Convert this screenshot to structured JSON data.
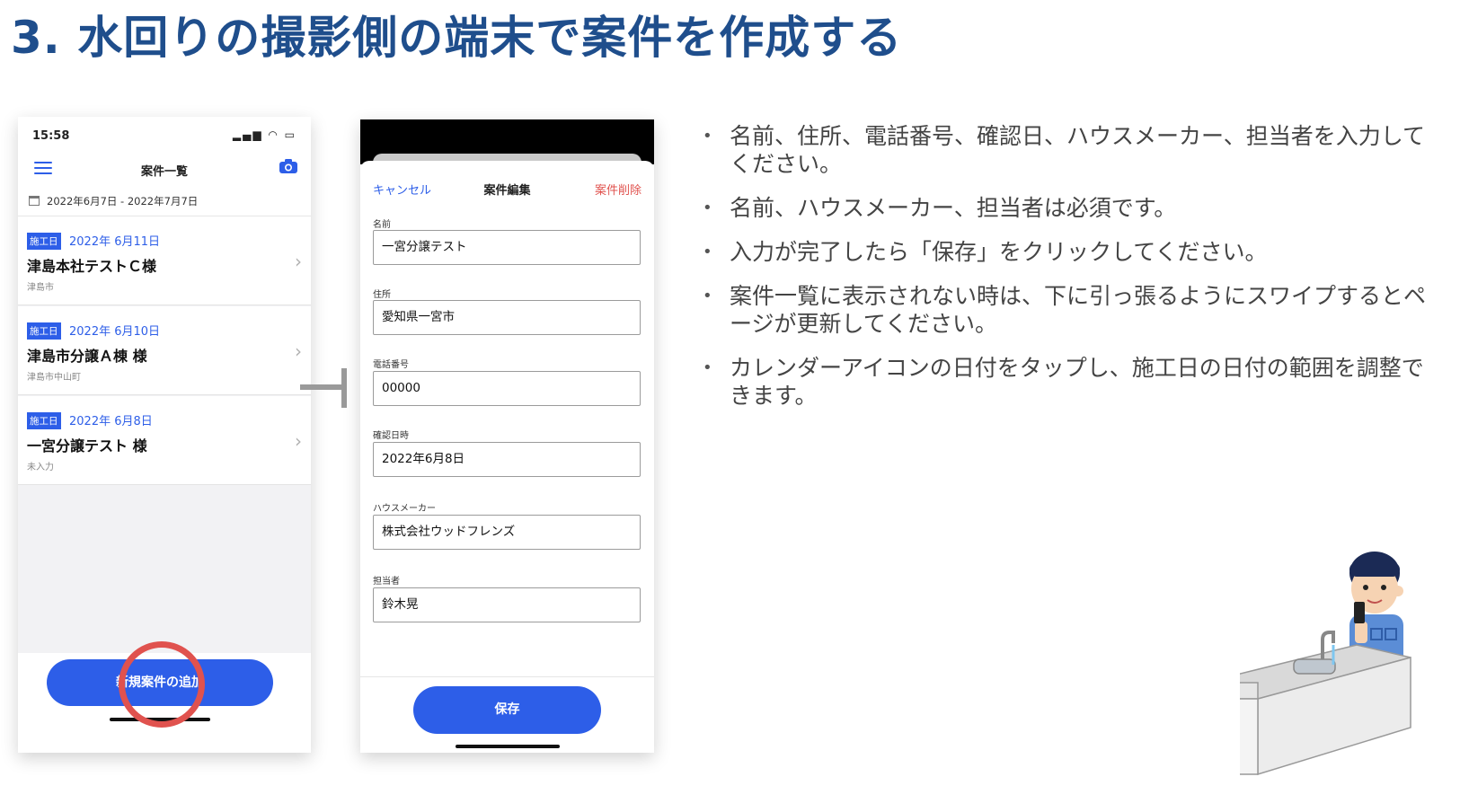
{
  "slide": {
    "title": "3. 水回りの撮影側の端末で案件を作成する"
  },
  "phone1": {
    "time": "15:58",
    "status_icons": "▂▄▆ ◠ ▭",
    "nav_title": "案件一覧",
    "date_range": "2022年6月7日 - 2022年7月7日",
    "items": [
      {
        "badge": "施工日",
        "date": "2022年 6月11日",
        "name": "津島本社テストＣ様",
        "address": "津島市"
      },
      {
        "badge": "施工日",
        "date": "2022年 6月10日",
        "name": "津島市分譲Ａ棟 様",
        "address": "津島市中山町"
      },
      {
        "badge": "施工日",
        "date": "2022年 6月8日",
        "name": "一宮分譲テスト 様",
        "address": "未入力"
      }
    ],
    "add_button": "新規案件の追加"
  },
  "phone2": {
    "cancel": "キャンセル",
    "title": "案件編集",
    "delete": "案件削除",
    "fields": [
      {
        "label": "名前",
        "value": "一宮分譲テスト"
      },
      {
        "label": "住所",
        "value": "愛知県一宮市"
      },
      {
        "label": "電話番号",
        "value": "00000"
      },
      {
        "label": "確認日時",
        "value": "2022年6月8日"
      },
      {
        "label": "ハウスメーカー",
        "value": "株式会社ウッドフレンズ"
      },
      {
        "label": "担当者",
        "value": "鈴木晃"
      }
    ],
    "save_button": "保存"
  },
  "bullets": [
    "名前、住所、電話番号、確認日、ハウスメーカー、担当者を入力してください。",
    "名前、ハウスメーカー、担当者は必須です。",
    "入力が完了したら「保存」をクリックしてください。",
    "案件一覧に表示されない時は、下に引っ張るようにスワイプするとページが更新してください。",
    "カレンダーアイコンの日付をタップし、施工日の日付の範囲を調整できます。"
  ],
  "colors": {
    "title": "#1f4e8c",
    "accent": "#2d5ee8",
    "danger": "#e0524e",
    "highlight": "#e0524e"
  }
}
